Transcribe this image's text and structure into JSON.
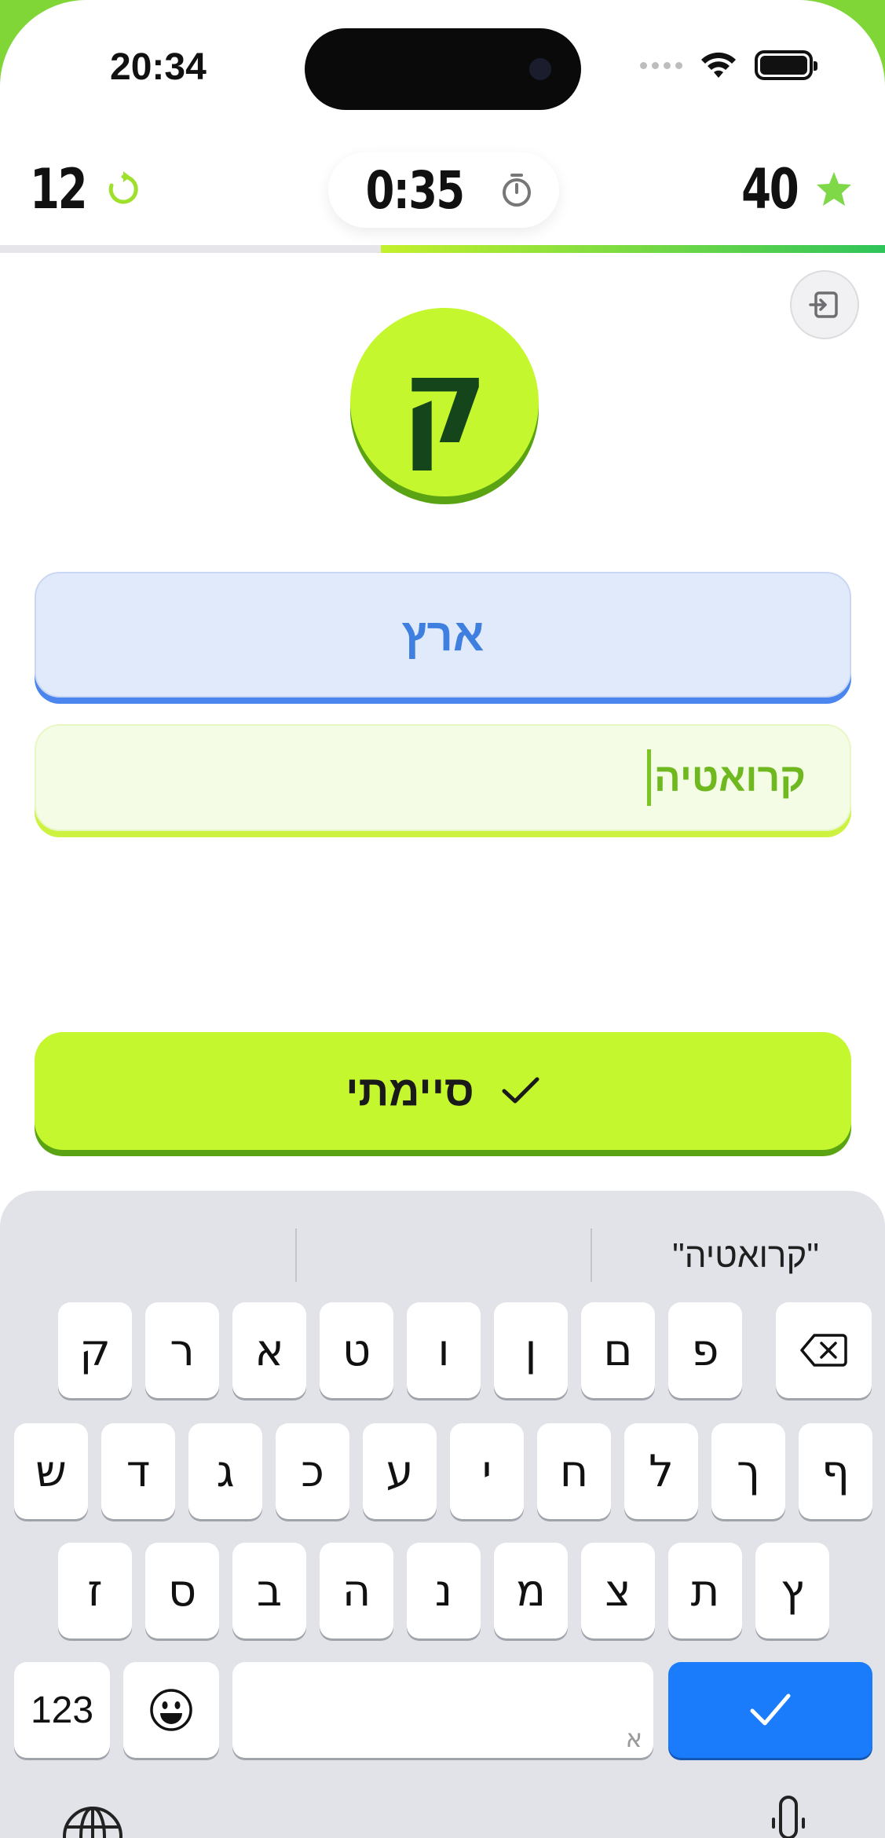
{
  "status_bar": {
    "time": "20:34"
  },
  "header": {
    "retries": "12",
    "timer": "0:35",
    "score": "40",
    "progress_fraction": 0.57
  },
  "round": {
    "letter": "ק",
    "category": "ארץ",
    "answer_value": "קרואטיה"
  },
  "done_button": {
    "label": "סיימתי"
  },
  "keyboard": {
    "suggestion": "\"קרואטיה\"",
    "row1": [
      "ק",
      "ר",
      "א",
      "ט",
      "ו",
      "ן",
      "ם",
      "פ"
    ],
    "row2": [
      "ש",
      "ד",
      "ג",
      "כ",
      "ע",
      "י",
      "ח",
      "ל",
      "ך",
      "ף"
    ],
    "row3": [
      "ז",
      "ס",
      "ב",
      "ה",
      "נ",
      "מ",
      "צ",
      "ת",
      "ץ"
    ],
    "numbers_label": "123",
    "space_hint": "א"
  },
  "colors": {
    "accent_lime": "#c4f72e",
    "accent_green_dark": "#5aa312",
    "category_blue": "#3f7fe0",
    "enter_blue": "#1a7cfa"
  }
}
